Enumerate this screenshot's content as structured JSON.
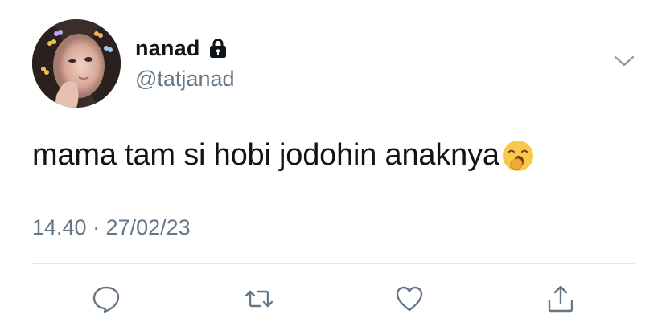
{
  "user": {
    "display_name": "nanad",
    "handle": "@tatjanad",
    "protected_icon": "lock-icon",
    "avatar": "avatar-photo"
  },
  "tweet": {
    "text": "mama tam si hobi jodohin anaknya",
    "emoji": "yawning-face-emoji",
    "timestamp": "14.40 · 27/02/23"
  },
  "menu": {
    "icon": "chevron-down-icon"
  },
  "actions": [
    {
      "name": "reply",
      "icon": "speech-bubble-icon"
    },
    {
      "name": "retweet",
      "icon": "retweet-icon"
    },
    {
      "name": "like",
      "icon": "heart-icon"
    },
    {
      "name": "share",
      "icon": "share-icon"
    }
  ],
  "colors": {
    "text_primary": "#0f1419",
    "text_secondary": "#657786",
    "icon_gray": "#657786",
    "divider": "#e1e8ed",
    "background": "#ffffff"
  }
}
